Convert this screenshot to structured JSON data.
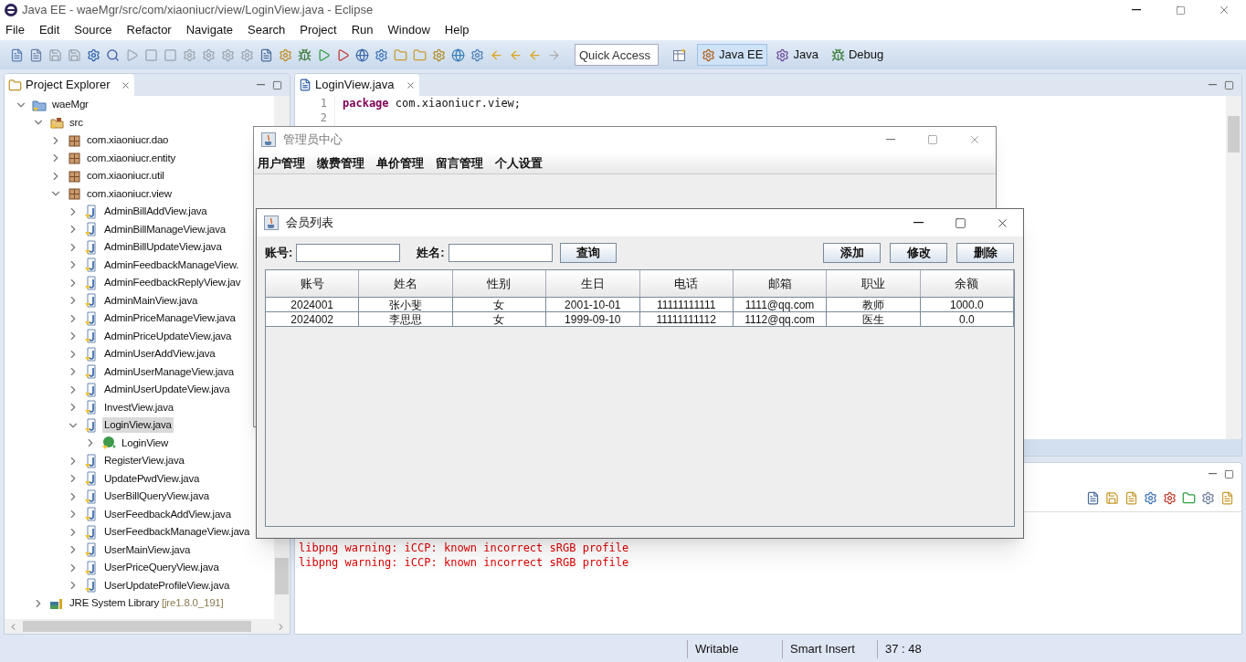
{
  "window": {
    "title": "Java EE - waeMgr/src/com/xiaoniucr/view/LoginView.java - Eclipse"
  },
  "menu": [
    "File",
    "Edit",
    "Source",
    "Refactor",
    "Navigate",
    "Search",
    "Project",
    "Run",
    "Window",
    "Help"
  ],
  "quick_access": {
    "placeholder": "Quick Access"
  },
  "perspectives": [
    {
      "label": "Java EE",
      "selected": true
    },
    {
      "label": "Java",
      "selected": false
    },
    {
      "label": "Debug",
      "selected": false
    }
  ],
  "project_explorer": {
    "title": "Project Explorer",
    "tree": [
      {
        "label": "waeMgr",
        "kind": "project",
        "expanded": true,
        "selected": false,
        "children": [
          {
            "label": "src",
            "kind": "folder",
            "expanded": true,
            "selected": false,
            "children": [
              {
                "label": "com.xiaoniucr.dao",
                "kind": "package",
                "expanded": false,
                "selected": false
              },
              {
                "label": "com.xiaoniucr.entity",
                "kind": "package",
                "expanded": false,
                "selected": false
              },
              {
                "label": "com.xiaoniucr.util",
                "kind": "package",
                "expanded": false,
                "selected": false
              },
              {
                "label": "com.xiaoniucr.view",
                "kind": "package",
                "expanded": true,
                "selected": false,
                "children": [
                  {
                    "label": "AdminBillAddView.java",
                    "kind": "file",
                    "expanded": false,
                    "selected": false
                  },
                  {
                    "label": "AdminBillManageView.java",
                    "kind": "file",
                    "expanded": false,
                    "selected": false
                  },
                  {
                    "label": "AdminBillUpdateView.java",
                    "kind": "file",
                    "expanded": false,
                    "selected": false
                  },
                  {
                    "label": "AdminFeedbackManageView.",
                    "kind": "file",
                    "expanded": false,
                    "selected": false
                  },
                  {
                    "label": "AdminFeedbackReplyView.jav",
                    "kind": "file",
                    "expanded": false,
                    "selected": false
                  },
                  {
                    "label": "AdminMainView.java",
                    "kind": "file",
                    "expanded": false,
                    "selected": false
                  },
                  {
                    "label": "AdminPriceManageView.java",
                    "kind": "file",
                    "expanded": false,
                    "selected": false
                  },
                  {
                    "label": "AdminPriceUpdateView.java",
                    "kind": "file",
                    "expanded": false,
                    "selected": false
                  },
                  {
                    "label": "AdminUserAddView.java",
                    "kind": "file",
                    "expanded": false,
                    "selected": false
                  },
                  {
                    "label": "AdminUserManageView.java",
                    "kind": "file",
                    "expanded": false,
                    "selected": false
                  },
                  {
                    "label": "AdminUserUpdateView.java",
                    "kind": "file",
                    "expanded": false,
                    "selected": false
                  },
                  {
                    "label": "InvestView.java",
                    "kind": "file",
                    "expanded": false,
                    "selected": false
                  },
                  {
                    "label": "LoginView.java",
                    "kind": "file",
                    "expanded": true,
                    "selected": true,
                    "children": [
                      {
                        "label": "LoginView",
                        "kind": "class",
                        "expanded": false,
                        "selected": false
                      }
                    ]
                  },
                  {
                    "label": "RegisterView.java",
                    "kind": "file",
                    "expanded": false,
                    "selected": false
                  },
                  {
                    "label": "UpdatePwdView.java",
                    "kind": "file",
                    "expanded": false,
                    "selected": false
                  },
                  {
                    "label": "UserBillQueryView.java",
                    "kind": "file",
                    "expanded": false,
                    "selected": false
                  },
                  {
                    "label": "UserFeedbackAddView.java",
                    "kind": "file",
                    "expanded": false,
                    "selected": false
                  },
                  {
                    "label": "UserFeedbackManageView.java",
                    "kind": "file",
                    "expanded": false,
                    "selected": false
                  },
                  {
                    "label": "UserMainView.java",
                    "kind": "file",
                    "expanded": false,
                    "selected": false
                  },
                  {
                    "label": "UserPriceQueryView.java",
                    "kind": "file",
                    "expanded": false,
                    "selected": false
                  },
                  {
                    "label": "UserUpdateProfileView.java",
                    "kind": "file",
                    "expanded": false,
                    "selected": false
                  }
                ]
              }
            ]
          },
          {
            "label": "JRE System Library",
            "suffix": "[jre1.8.0_191]",
            "kind": "library",
            "expanded": false,
            "selected": false
          }
        ]
      }
    ]
  },
  "editor": {
    "tab": "LoginView.java",
    "line_numbers": [
      "1",
      "2"
    ],
    "keyword": "package",
    "code": " com.xiaoniucr.view;"
  },
  "console": {
    "lines": [
      "libpng warning: iCCP: known incorrect sRGB profile",
      "libpng warning: iCCP: known incorrect sRGB profile"
    ]
  },
  "status_bar": [
    "Writable",
    "Smart Insert",
    "37 : 48"
  ],
  "admin_window": {
    "title": "管理员中心",
    "menu": [
      "用户管理",
      "缴费管理",
      "单价管理",
      "留言管理",
      "个人设置"
    ]
  },
  "member_window": {
    "title": "会员列表",
    "fields": [
      {
        "label": "账号:"
      },
      {
        "label": "姓名:"
      }
    ],
    "search_button": "查询",
    "buttons": [
      "添加",
      "修改",
      "删除"
    ],
    "table": {
      "columns": [
        "账号",
        "姓名",
        "性别",
        "生日",
        "电话",
        "邮箱",
        "职业",
        "余额"
      ],
      "rows": [
        [
          "2024001",
          "张小斐",
          "女",
          "2001-10-01",
          "11111111111",
          "1111@qq.com",
          "教师",
          "1000.0"
        ],
        [
          "2024002",
          "李思思",
          "女",
          "1999-09-10",
          "11111111112",
          "1112@qq.com",
          "医生",
          "0.0"
        ]
      ]
    }
  }
}
